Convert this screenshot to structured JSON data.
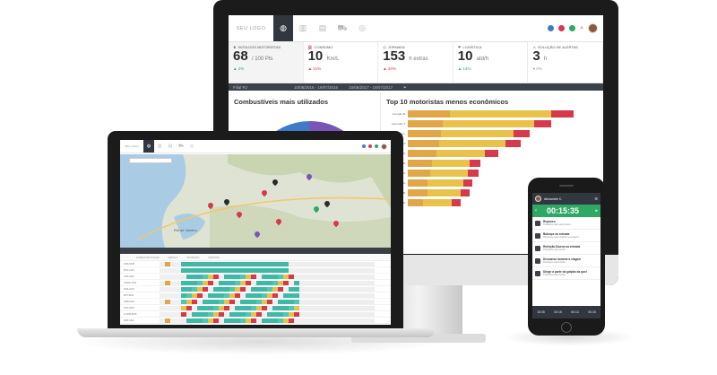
{
  "colors": {
    "accent_green": "#2ea864",
    "bar_orange": "#e0a648",
    "bar_yellow": "#e8c24b",
    "bar_red": "#d6394b",
    "dark_nav": "#31363f",
    "pie_blue": "#3f7ac7",
    "pie_purple": "#7a55b8"
  },
  "monitor": {
    "logo": "SEU LOGO",
    "nav_icons": [
      "globe-icon",
      "chart-icon",
      "document-icon",
      "truck-icon",
      "gauge-icon"
    ],
    "header_icons": [
      "chat-icon",
      "alert-icon",
      "message-icon",
      "search-icon"
    ],
    "kpis": [
      {
        "label": "NOTA DOS MOTORISTAS",
        "value": "68",
        "unit": "/ 100 Pts",
        "delta": "▲ 2%",
        "delta_color": "#2ea864"
      },
      {
        "label": "CONSUMO",
        "value": "10",
        "unit": "Km/L",
        "delta": "▲ 21%",
        "delta_color": "#d6394b"
      },
      {
        "label": "JORNADA",
        "value": "153",
        "unit": "h extras",
        "delta": "▲ 34%",
        "delta_color": "#d6394b"
      },
      {
        "label": "LOGÍSTICA",
        "value": "10",
        "unit": "atd/h",
        "delta": "▲ 14%",
        "delta_color": "#2ea864"
      },
      {
        "label": "SOLUÇÃO DE ALERTAS",
        "value": "3",
        "unit": "h",
        "delta": "● 0%",
        "delta_color": "#999999"
      }
    ],
    "filter": {
      "branch": "Filial RJ",
      "range1": "10/06/2016 - 19/07/2016",
      "range2": "10/06/2017 - 19/07/2017"
    },
    "left_panel_title": "Combustíveis mais utilizados",
    "right_panel_title": "Top 10 motoristas menos econômicos",
    "bars": [
      {
        "label": "Gonçalo M.",
        "segs": [
          38,
          92,
          20
        ]
      },
      {
        "label": "Fernando T.",
        "segs": [
          32,
          82,
          16
        ]
      },
      {
        "label": "Ana L.",
        "segs": [
          30,
          66,
          14
        ]
      },
      {
        "label": "Júlio P.",
        "segs": [
          28,
          60,
          14
        ]
      },
      {
        "label": "Marcos S.",
        "segs": [
          26,
          44,
          12
        ]
      },
      {
        "label": "Fábio R.",
        "segs": [
          22,
          34,
          10
        ]
      },
      {
        "label": "Paulo C.",
        "segs": [
          20,
          34,
          10
        ]
      },
      {
        "label": "Sérgio A.",
        "segs": [
          18,
          32,
          8
        ]
      },
      {
        "label": "Lucas B.",
        "segs": [
          18,
          30,
          8
        ]
      },
      {
        "label": "Rita D.",
        "segs": [
          14,
          26,
          8
        ]
      }
    ]
  },
  "laptop": {
    "logo": "SEU LOGO",
    "map_label": "Rio de Janeiro",
    "grid_headers": [
      "CONDUTOR TITULAR",
      "VEÍCULO",
      "OCUPAÇÃO",
      "EVENTOS"
    ],
    "grid_rows": [
      "AWS-5678",
      "MNL-1312",
      "OPS-3040",
      "CIGRA-4574",
      "NNS-2123",
      "FPP-6611",
      "NWB-3211",
      "HCA-3000",
      "CLJNR-5678",
      "SMP-4321"
    ]
  },
  "phone": {
    "user_name": "Alexandre C.",
    "timer": "00:15:35",
    "items": [
      {
        "title": "Repouso",
        "sub": "Pressione aqui para iniciar"
      },
      {
        "title": "Balança na entrada",
        "sub": "Pressione para realizar a pesagem"
      },
      {
        "title": "Refeição Diurna na entrada",
        "sub": "Pressione para iniciar"
      },
      {
        "title": "Descanso durante a viagem",
        "sub": "Pressione para iniciar"
      },
      {
        "title": "Dirigir a parte do galpão da quel",
        "sub": "Pressione para iniciar"
      }
    ],
    "footer": [
      "15:35",
      "00:15",
      "00:13",
      "00:15"
    ]
  }
}
